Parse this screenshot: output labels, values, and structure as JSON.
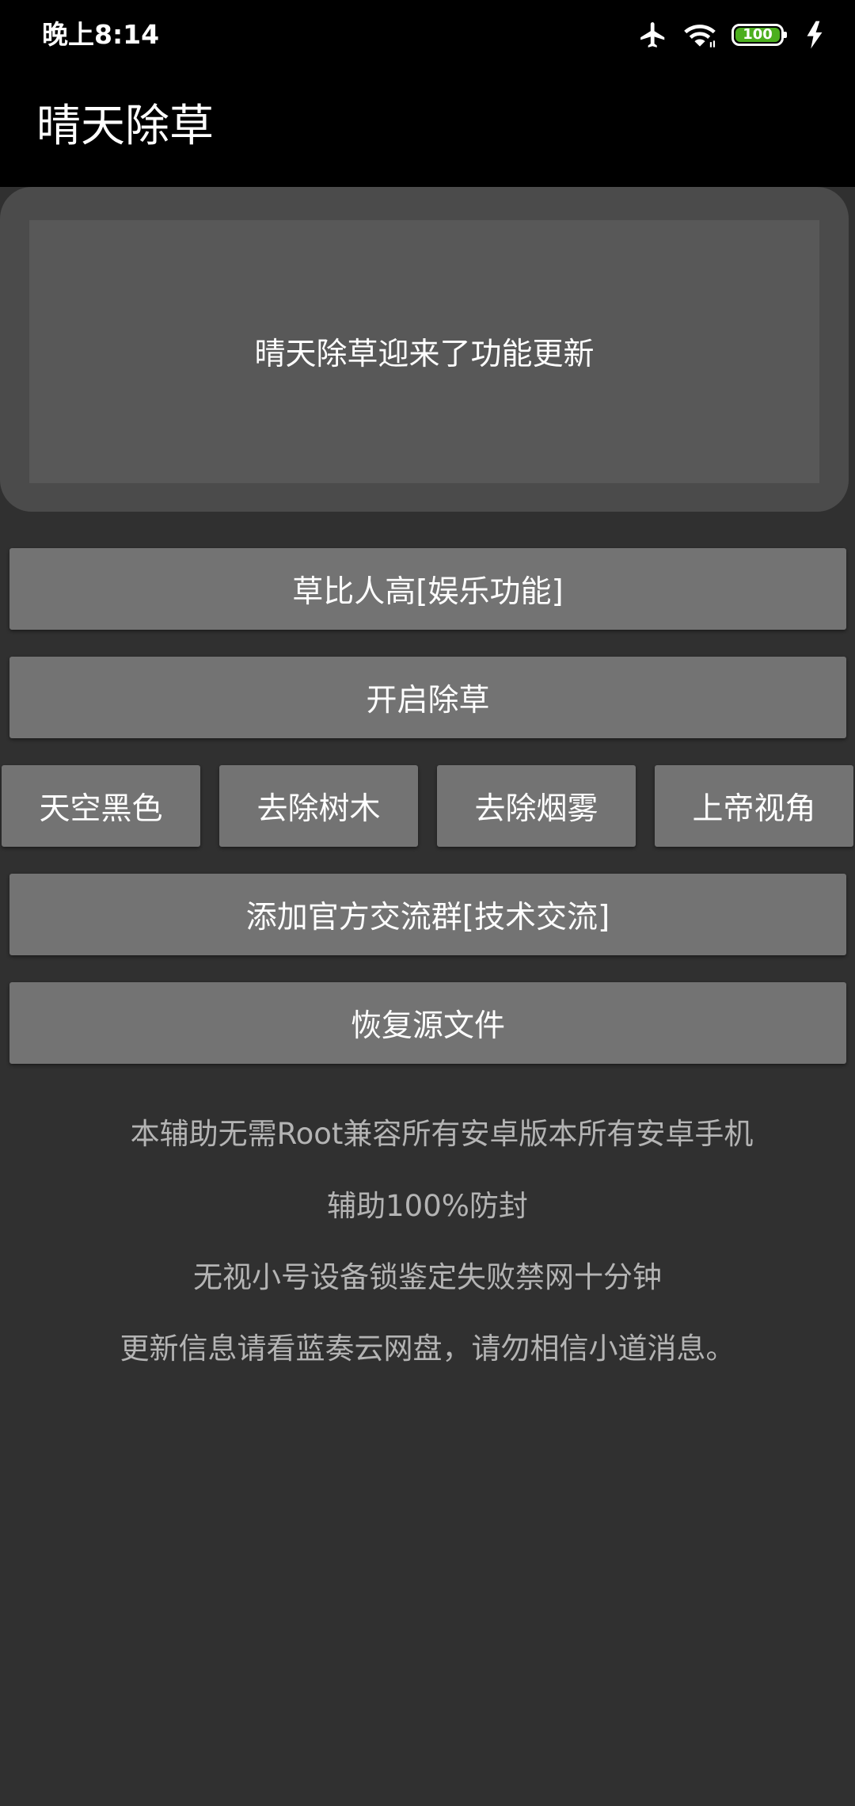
{
  "status_bar": {
    "time": "晚上8:14",
    "icons": [
      "airplane-icon",
      "wifi-icon",
      "battery-icon",
      "charging-icon"
    ],
    "battery_level": "100",
    "battery_color": "#4caf1e"
  },
  "app_bar": {
    "title": "晴天除草"
  },
  "banner": {
    "text": "晴天除草迎来了功能更新"
  },
  "buttons": {
    "grass_tall": "草比人高[娱乐功能]",
    "start_weeding": "开启除草",
    "sky_black": "天空黑色",
    "remove_trees": "去除树木",
    "remove_smoke": "去除烟雾",
    "god_view": "上帝视角",
    "join_group": "添加官方交流群[技术交流]",
    "restore_files": "恢复源文件"
  },
  "info": {
    "lines": [
      "本辅助无需Root兼容所有安卓版本所有安卓手机",
      "辅助100%防封",
      "无视小号设备锁鉴定失败禁网十分钟",
      "更新信息请看蓝奏云网盘，请勿相信小道消息。"
    ]
  }
}
